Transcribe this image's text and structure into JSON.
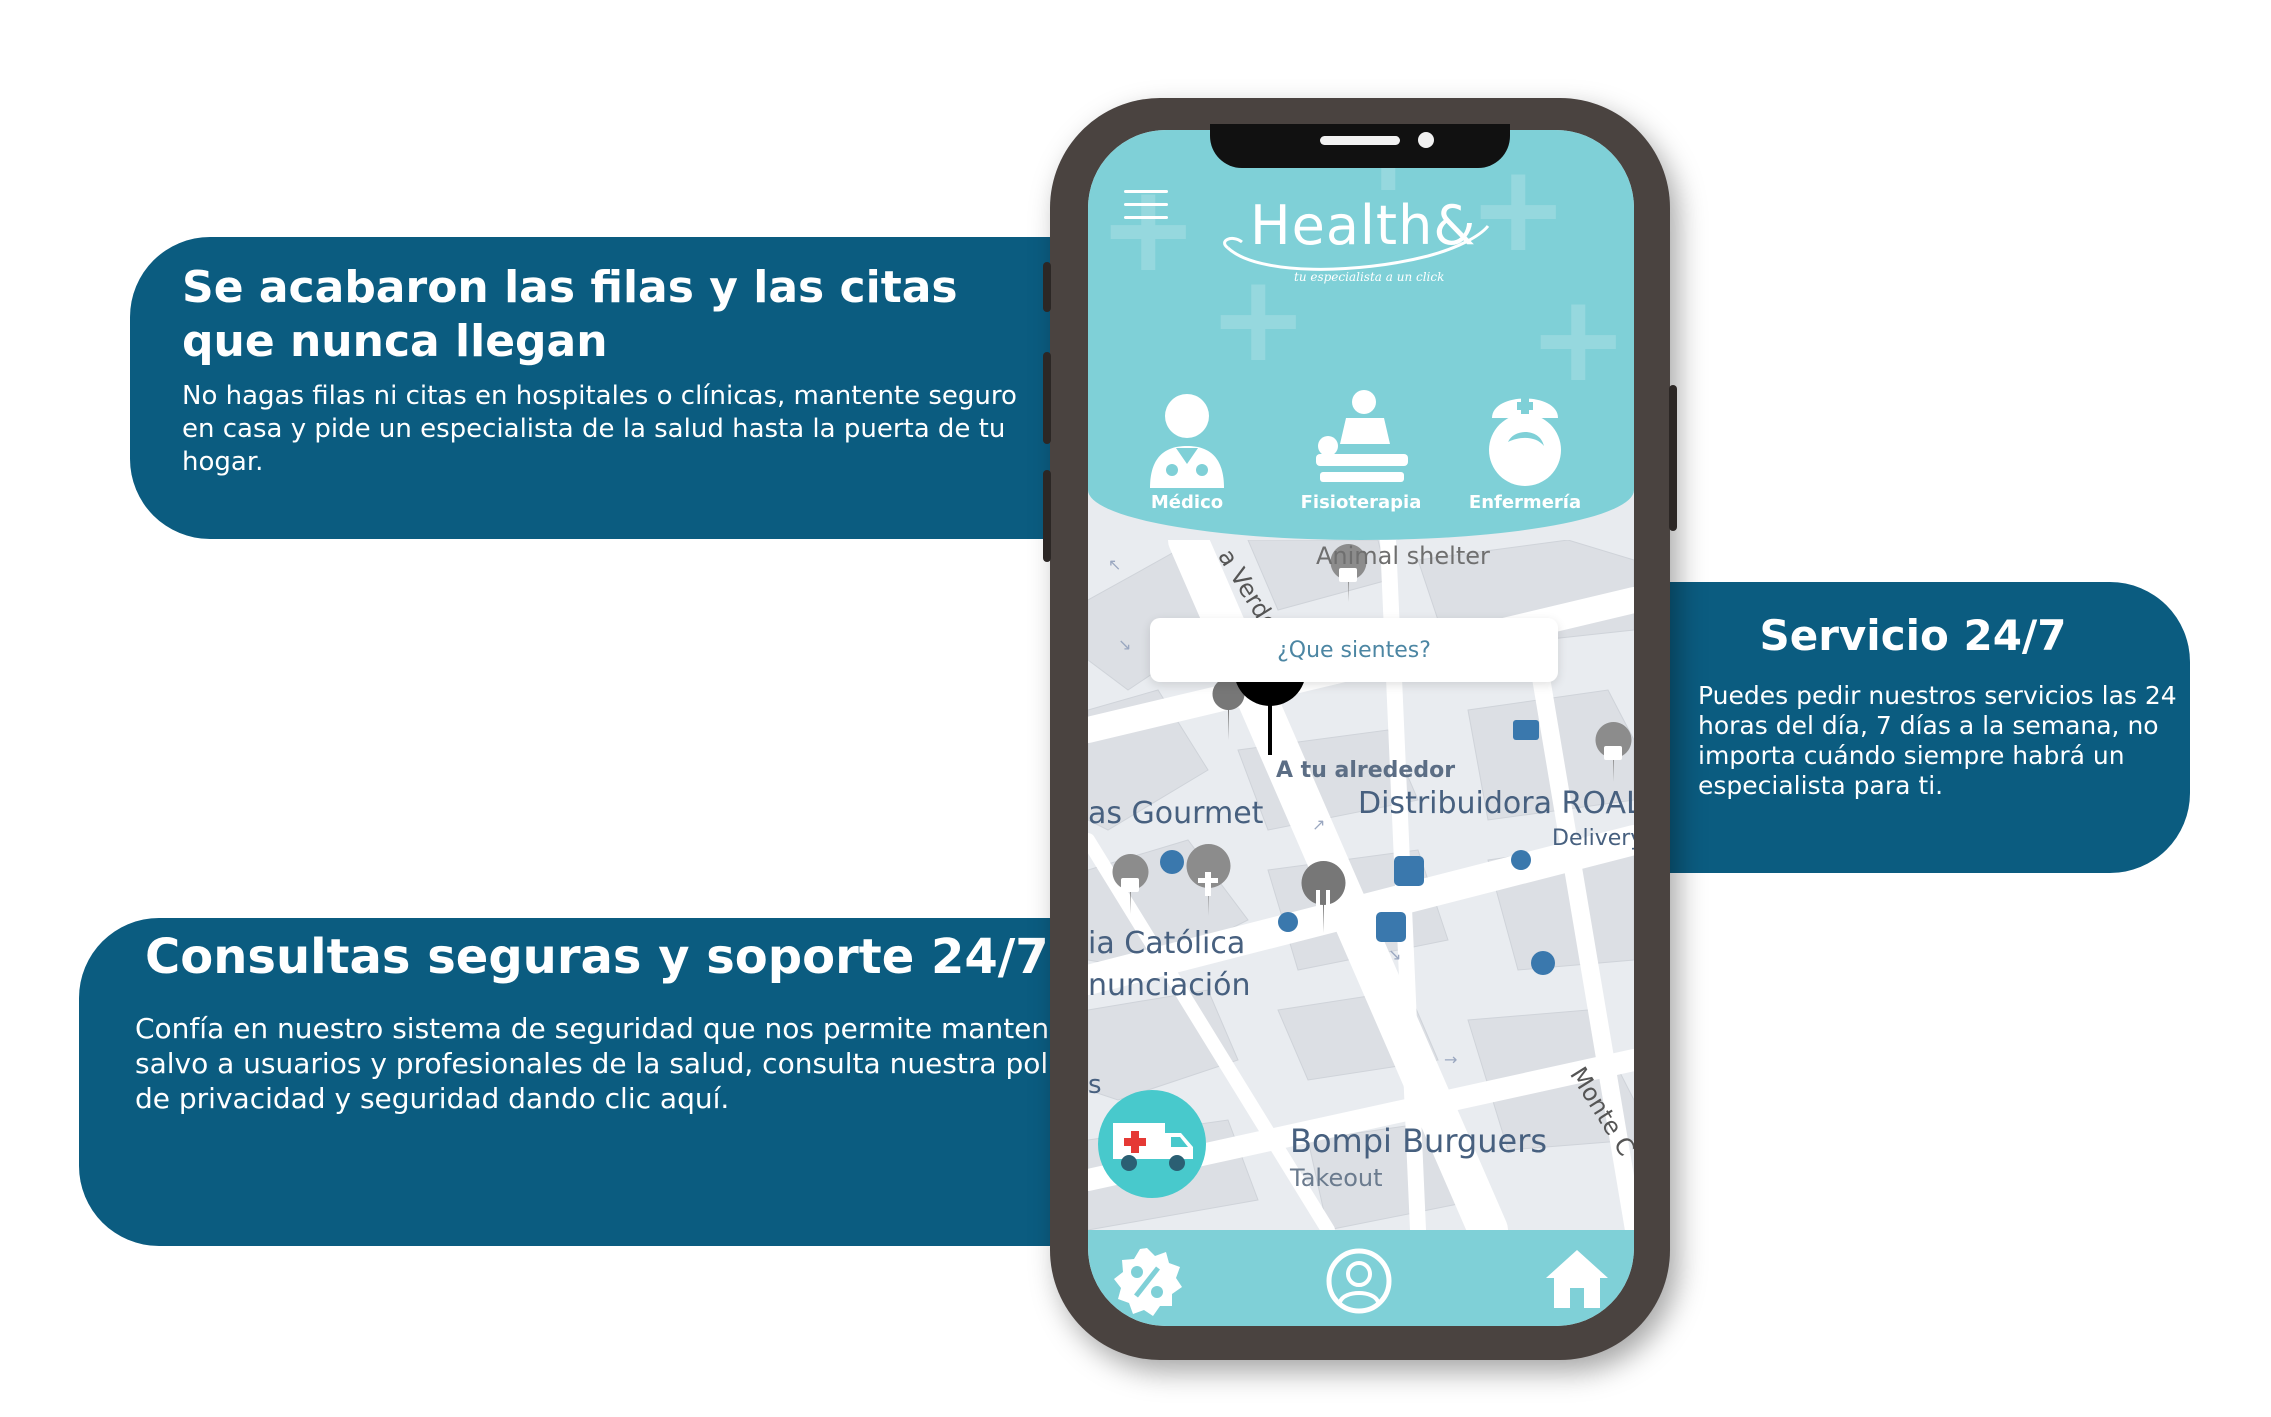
{
  "cards": {
    "no_lines": {
      "title": "Se acabaron las filas y las citas que nunca llegan",
      "body": "No hagas filas ni citas en hospitales o clínicas, mantente seguro en casa y pide un especialista de la salud hasta la puerta de tu hogar."
    },
    "service_247": {
      "title": "Servicio 24/7",
      "body": "Puedes pedir nuestros servicios las 24 horas del día, 7 días a la semana, no importa cuándo siempre habrá un especialista para ti."
    },
    "secure_consults": {
      "title": "Consultas seguras y soporte 24/7",
      "body": "Confía en nuestro sistema de seguridad que nos permite mantener a salvo a usuarios y profesionales de la salud, consulta nuestra política de privacidad y seguridad dando clic aquí."
    }
  },
  "app": {
    "logo": "Health&",
    "tagline": "tu especialista a un click",
    "services": [
      {
        "label": "Médico",
        "icon": "doctor-icon"
      },
      {
        "label": "Fisioterapia",
        "icon": "physiotherapy-icon"
      },
      {
        "label": "Enfermería",
        "icon": "nurse-icon"
      }
    ],
    "search_placeholder": "¿Que sientes?",
    "map_labels": {
      "animal_shelter": "Animal shelter",
      "street_verde": "a Verde",
      "around_you": "A tu alrededor",
      "distribuidora": "Distribuidora ROAL",
      "delivery": "Delivery",
      "gourmet": "as Gourmet",
      "catolica": "ia Católica",
      "anunciacion": "nunciación",
      "bompi": "Bompi Burguers",
      "takeout": "Takeout",
      "monte": "Monte C",
      "side_s": "s"
    },
    "nav": [
      "discount-icon",
      "profile-icon",
      "home-icon"
    ],
    "colors": {
      "header": "#7fd0d7",
      "card": "#0b5c80",
      "accent": "#48c9cc"
    }
  }
}
